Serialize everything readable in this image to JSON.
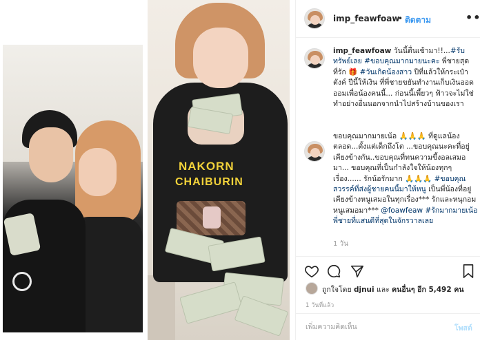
{
  "post": {
    "username": "imp_feawfoaw",
    "separator": "•",
    "follow_label": "ติดตาม",
    "more_label": "•••"
  },
  "caption": {
    "username": "imp_feawfoaw",
    "text_a": " วันนี้ตื่นเช้ามา!!...",
    "tag1": "#รับทรัพย์เลย",
    "text_b": " ",
    "tag2": "#ขอบคุณมากมายนะคะ",
    "text_c": " พี่ชายสุดที่รัก 🎁 ",
    "tag3": "#วันเกิดน้องสาว",
    "text_d": " ปีที่แล้วให้กระเป๋าตังค์ ปีนี้ให้เงิน ที่พี่ชายขยันทำงานเก็บเงินออดออมเพื่อน้องคนนี้... ก่อนนี้เพี้ยวๆ ฟ้าวจะไม่ใช่ทำอย่างอื่นนอกจากนำไปสร้างบ้านของเรา"
  },
  "reply": {
    "text_a": "ขอบคุณมากมายเน้อ 🙏🙏🙏 ที่ดูแลน้องตลอด...ตั้งแต่เด็กถึงโต ...ขอบคุณนะคะที่อยู่เคียงข้างกัน..ขอบคุณที่ทนความขี้งอลเสมอมา... ขอบคุณที่เป็นกำลังใจให้น้องทุกๆเรื่อง...... รักน้อรักมาก 🙏🙏🙏 ",
    "tag1": "#ขอบคุณสวรรค์ที่ส่งผู้ชายคนนี้มาให้หนู",
    "text_b": " เป็นพี่น้องที่อยู่เคียงข้างหนูเสมอในทุกเรื่อง*** รักและหนุกอมหนูเสมอมา*** ",
    "mention": "@foawfeaw",
    "text_c": " ",
    "tag2": "#รักมากมายเน้อพี่ชายที่แสนดีที่สุดในจักรวาลเลย",
    "time": "1 วัน"
  },
  "likes": {
    "prefix": "ถูกใจโดย ",
    "user": "djnui",
    "middle": " และ ",
    "others": "คนอื่นๆ อีก 5,492 คน"
  },
  "timestamp": "1 วันที่แล้ว",
  "comment": {
    "placeholder": "เพิ่มความคิดเห็น",
    "post_label": "โพสต์"
  },
  "photo": {
    "shirt_line1": "NAKORN",
    "shirt_line2": "CHAIBURIN"
  },
  "icons": [
    "heart-icon",
    "comment-icon",
    "share-icon",
    "bookmark-icon",
    "more-icon"
  ]
}
